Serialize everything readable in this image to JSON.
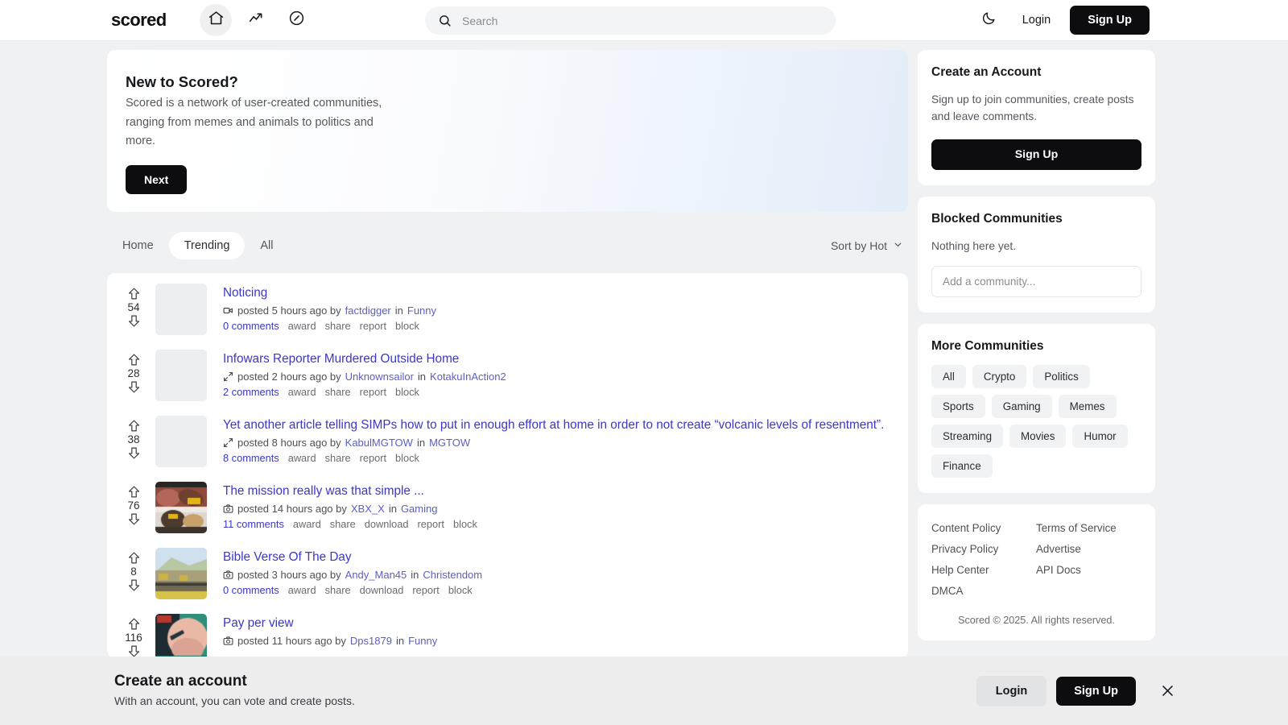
{
  "header": {
    "brand": "scored",
    "nav": [
      {
        "name": "home-icon",
        "label": "Home"
      },
      {
        "name": "trending-icon",
        "label": "Trending"
      },
      {
        "name": "explore-icon",
        "label": "Explore"
      }
    ],
    "search": {
      "placeholder": "Search",
      "value": ""
    },
    "theme_toggle": "moon-icon",
    "login_label": "Login",
    "signup_label": "Sign Up"
  },
  "welcome": {
    "title": "New to Scored?",
    "body": "Scored is a network of user-created communities, ranging from memes and animals to politics and more.",
    "next_label": "Next"
  },
  "tabs": [
    {
      "label": "Home",
      "active": false
    },
    {
      "label": "Trending",
      "active": true
    },
    {
      "label": "All",
      "active": false
    }
  ],
  "sort": {
    "label": "Sort by Hot"
  },
  "posts": [
    {
      "score": "54",
      "title": "Noticing",
      "type_icon": "video-icon",
      "meta": "posted 5 hours ago by",
      "author": "factdigger",
      "in": "in",
      "community": "Funny",
      "comments": "0 comments",
      "actions": [
        "award",
        "share",
        "report",
        "block"
      ],
      "thumb": "blank"
    },
    {
      "score": "28",
      "title": "Infowars Reporter Murdered Outside Home",
      "type_icon": "link-icon",
      "meta": "posted 2 hours ago by",
      "author": "Unknownsailor",
      "in": "in",
      "community": "KotakuInAction2",
      "comments": "2 comments",
      "actions": [
        "award",
        "share",
        "report",
        "block"
      ],
      "thumb": "blank"
    },
    {
      "score": "38",
      "title": "Yet another article telling SIMPs how to put in enough effort at home in order to not create “volcanic levels of resentment”.",
      "type_icon": "link-icon",
      "meta": "posted 8 hours ago by",
      "author": "KabulMGTOW",
      "in": "in",
      "community": "MGTOW",
      "comments": "8 comments",
      "actions": [
        "award",
        "share",
        "report",
        "block"
      ],
      "thumb": "blank"
    },
    {
      "score": "76",
      "title": "The mission really was that simple ...",
      "type_icon": "camera-icon",
      "meta": "posted 14 hours ago by",
      "author": "XBX_X",
      "in": "in",
      "community": "Gaming",
      "comments": "11 comments",
      "actions": [
        "award",
        "share",
        "download",
        "report",
        "block"
      ],
      "thumb": "meme-dragon"
    },
    {
      "score": "8",
      "title": "Bible Verse Of The Day",
      "type_icon": "camera-icon",
      "meta": "posted 3 hours ago by",
      "author": "Andy_Man45",
      "in": "in",
      "community": "Christendom",
      "comments": "0 comments",
      "actions": [
        "award",
        "share",
        "download",
        "report",
        "block"
      ],
      "thumb": "landscape"
    },
    {
      "score": "116",
      "title": "Pay per view",
      "type_icon": "camera-icon",
      "meta": "posted 11 hours ago by",
      "author": "Dps1879",
      "in": "in",
      "community": "Funny",
      "comments": "",
      "actions": [],
      "thumb": "face"
    }
  ],
  "sidebar": {
    "create_account": {
      "title": "Create an Account",
      "body": "Sign up to join communities, create posts and leave comments.",
      "button": "Sign Up"
    },
    "blocked": {
      "title": "Blocked Communities",
      "empty": "Nothing here yet.",
      "input_placeholder": "Add a community..."
    },
    "more_communities": {
      "title": "More Communities",
      "chips": [
        "All",
        "Crypto",
        "Politics",
        "Sports",
        "Gaming",
        "Memes",
        "Streaming",
        "Movies",
        "Humor",
        "Finance"
      ]
    },
    "footer": {
      "links": [
        "Content Policy",
        "Terms of Service",
        "Privacy Policy",
        "Advertise",
        "Help Center",
        "API Docs",
        "DMCA"
      ],
      "copyright": "Scored © 2025. All rights reserved."
    }
  },
  "bottom_banner": {
    "title": "Create an account",
    "subtitle": "With an account, you can vote and create posts.",
    "login_label": "Login",
    "signup_label": "Sign Up",
    "close_icon": "close-icon"
  },
  "colors": {
    "accent_link": "#3b37c9",
    "dark_button": "#0d0d0f",
    "page_bg": "#f0f1f3"
  }
}
